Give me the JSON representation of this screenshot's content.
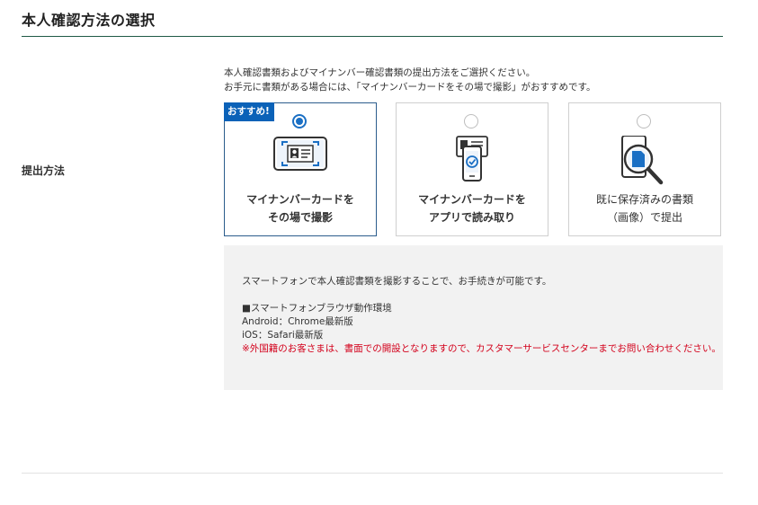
{
  "page": {
    "title": "本人確認方法の選択"
  },
  "form": {
    "field_label": "提出方法",
    "intro_lines": [
      "本人確認書類およびマイナンバー確認書類の提出方法をご選択ください。",
      "お手元に書類がある場合には、「マイナンバーカードをその場で撮影」がおすすめです。"
    ],
    "options": [
      {
        "badge": "おすすめ!",
        "label_lines": [
          "マイナンバーカードを",
          "その場で撮影"
        ],
        "icon": "id-card-camera-icon",
        "selected": true
      },
      {
        "label_lines": [
          "マイナンバーカードを",
          "アプリで読み取り"
        ],
        "icon": "phone-card-check-icon",
        "selected": false
      },
      {
        "label_lines": [
          "既に保存済みの書類",
          "（画像）で提出"
        ],
        "icon": "phone-magnifier-icon",
        "selected": false
      }
    ],
    "info": {
      "description": "スマートフォンで本人確認書類を撮影することで、お手続きが可能です。",
      "env_heading": "■スマートフォンブラウザ動作環境",
      "android": "Android：Chrome最新版",
      "ios": "iOS：Safari最新版",
      "warning": "※外国籍のお客さまは、書面での開設となりますので、カスタマーサービスセンターまでお問い合わせください。"
    }
  },
  "colors": {
    "accent": "#0b62b8",
    "rule": "#1f5a46",
    "warning": "#d3001b",
    "info_bg": "#f2f2f2"
  }
}
